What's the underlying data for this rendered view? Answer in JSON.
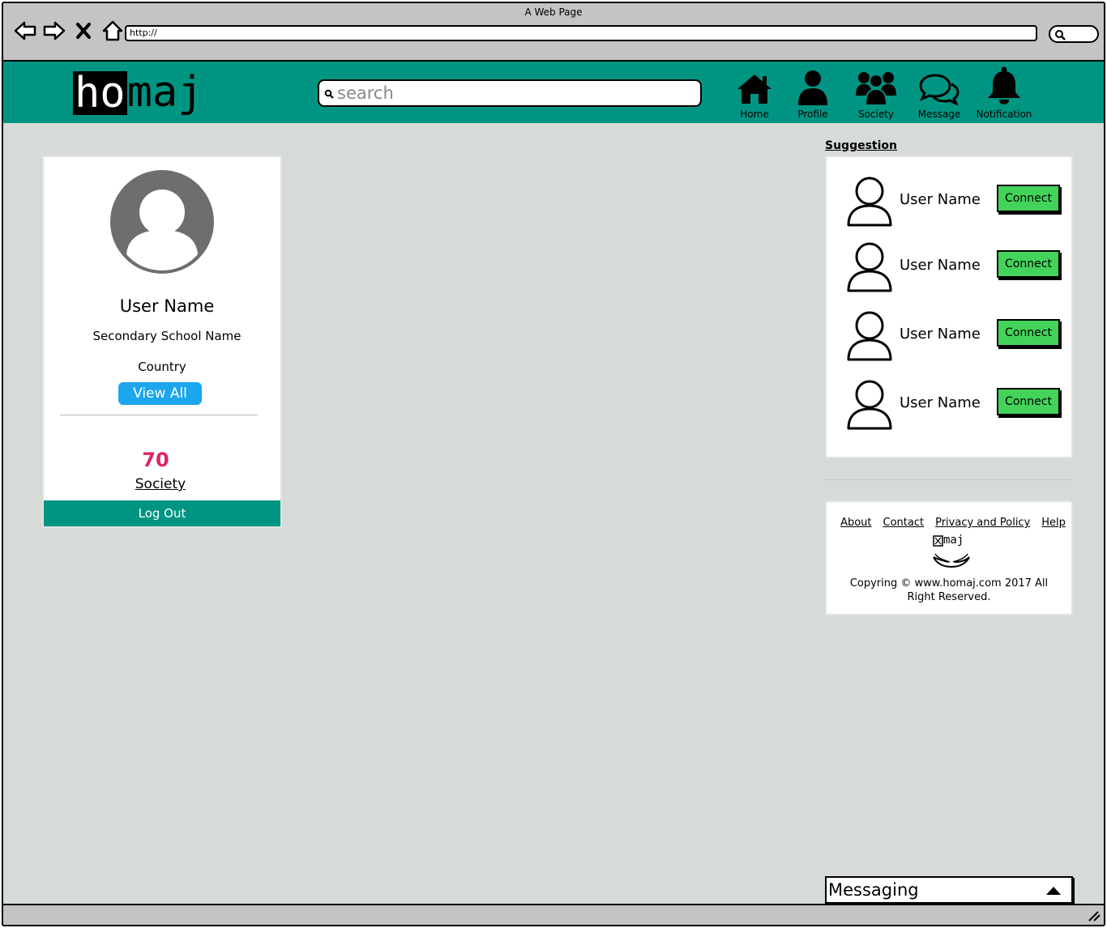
{
  "window": {
    "title": "A Web Page"
  },
  "browser": {
    "url": "http://"
  },
  "app": {
    "logo_part1": "ho",
    "logo_part2": "maj",
    "search_placeholder": "search",
    "brand_color": "#009582"
  },
  "nav": {
    "items": [
      {
        "label": "Home",
        "icon": "home-icon"
      },
      {
        "label": "Profile",
        "icon": "user-icon"
      },
      {
        "label": "Society",
        "icon": "users-group-icon"
      },
      {
        "label": "Message",
        "icon": "chat-bubbles-icon"
      },
      {
        "label": "Notification",
        "icon": "bell-icon"
      }
    ]
  },
  "profile": {
    "name": "User Name",
    "school": "Secondary School Name",
    "country": "Country",
    "view_all_label": "View All",
    "society_count": "70",
    "society_label": "Society",
    "logout_label": "Log Out"
  },
  "suggestion": {
    "heading": "Suggestion",
    "items": [
      {
        "name": "User Name",
        "action": "Connect"
      },
      {
        "name": "User Name",
        "action": "Connect"
      },
      {
        "name": "User Name",
        "action": "Connect"
      },
      {
        "name": "User Name",
        "action": "Connect"
      }
    ]
  },
  "footer": {
    "links": [
      "About",
      "Contact",
      "Privacy and Policy",
      "Help"
    ],
    "mini_logo_text": "maj",
    "copyright": "Copyring © www.homaj.com 2017 All Right Reserved."
  },
  "messaging": {
    "label": "Messaging"
  }
}
